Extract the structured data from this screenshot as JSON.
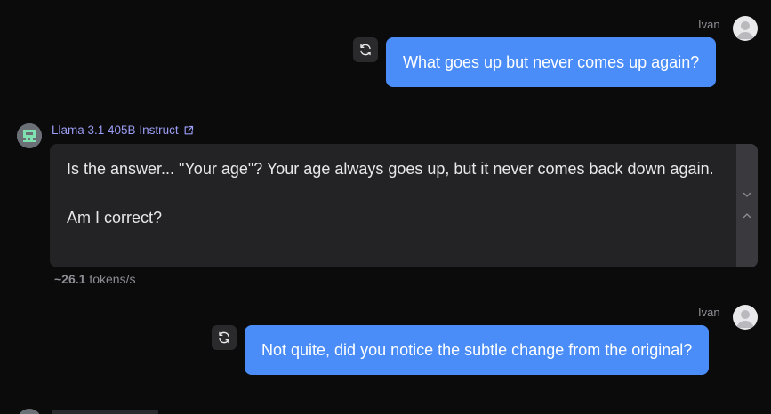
{
  "conversation": {
    "user_messages": [
      {
        "sender": "Ivan",
        "text": "What goes up but never comes up again?"
      },
      {
        "sender": "Ivan",
        "text": "Not quite, did you notice the subtle change from the original?"
      }
    ],
    "assistant": {
      "model_name": "Llama 3.1 405B Instruct",
      "paragraphs": [
        "Is the answer... \"Your age\"? Your age always goes up, but it never comes back down again.",
        "Am I correct?"
      ],
      "speed_value": "~26.1",
      "speed_unit": "tokens/s"
    }
  },
  "icons": {
    "user_avatar": "user-silhouette-icon",
    "bot_avatar": "robot-pixel-icon",
    "regenerate": "refresh-icon",
    "external_link": "external-link-icon",
    "scroll_down": "chevron-down-icon",
    "scroll_up": "chevron-up-icon"
  },
  "colors": {
    "background": "#0b0b0c",
    "user_bubble": "#4b8df8",
    "assistant_card": "#232326",
    "model_link": "#9b9cf3",
    "muted_text": "#8d8d93"
  }
}
